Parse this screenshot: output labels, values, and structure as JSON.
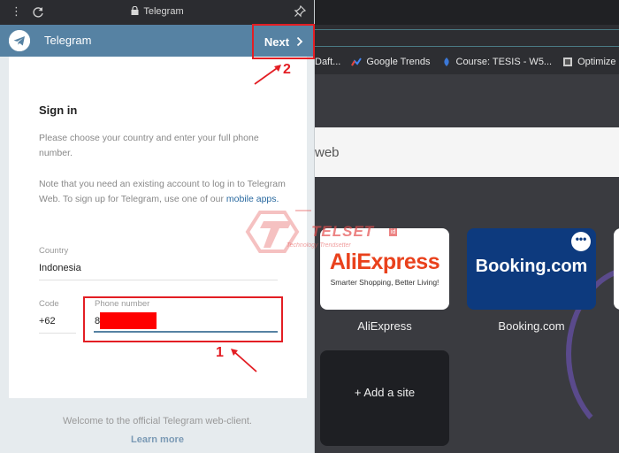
{
  "popup": {
    "chrome_title": "Telegram",
    "app_title": "Telegram",
    "next_label": "Next",
    "sign_in": "Sign in",
    "desc1": "Please choose your country and enter your full phone number.",
    "desc2_pre": "Note that you need an existing account to log in to Telegram Web. To sign up for Telegram, use one of our",
    "desc2_link": "mobile apps.",
    "country_label": "Country",
    "country_value": "Indonesia",
    "code_label": "Code",
    "code_value": "+62",
    "phone_label": "Phone number",
    "phone_value": "8",
    "welcome": "Welcome to the official Telegram web-client.",
    "learn_more": "Learn more"
  },
  "background": {
    "bookmarks": [
      {
        "label": "Daft...",
        "icon": "page-icon"
      },
      {
        "label": "Google Trends",
        "icon": "trends-icon"
      },
      {
        "label": "Course: TESIS - W5...",
        "icon": "course-icon"
      },
      {
        "label": "Optimize animat",
        "icon": "optimize-icon"
      }
    ],
    "search_text": "web",
    "tiles": {
      "aliexpress_logo": "AliExpress",
      "aliexpress_tagline": "Smarter Shopping, Better Living!",
      "aliexpress_label": "AliExpress",
      "booking_logo": "Booking.com",
      "booking_label": "Booking.com",
      "more_dots": "•••",
      "add_site": "+ Add a site"
    }
  },
  "annotations": {
    "num1": "1",
    "num2": "2",
    "color": "#e31e24"
  },
  "watermark": {
    "brand": "TELSET",
    "badge": "id",
    "tagline": "Technology Trendsetter"
  },
  "colors": {
    "telegram_header": "#5682a3",
    "redaction": "#ff0000"
  }
}
